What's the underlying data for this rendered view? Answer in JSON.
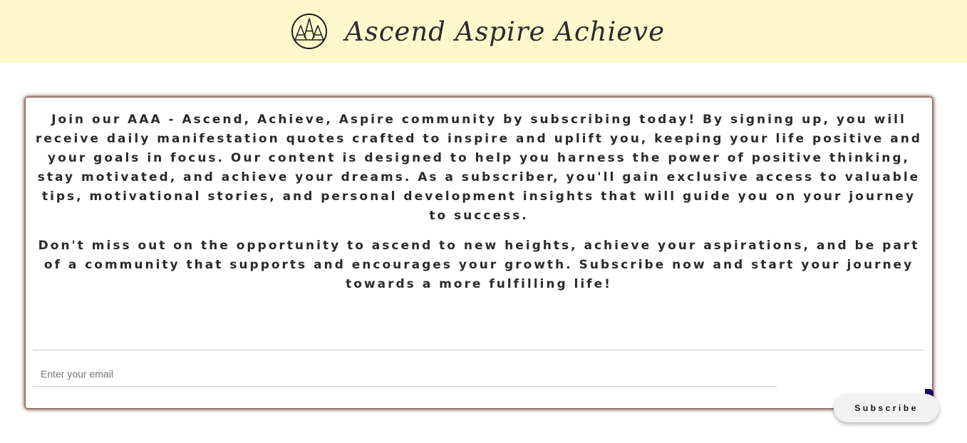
{
  "header": {
    "logo_icon": "AAA-monogram-circle-icon",
    "title": "Ascend Aspire Achieve",
    "background_color": "#fef9cd"
  },
  "card": {
    "paragraph_1": "Join our AAA - Ascend, Achieve, Aspire community by subscribing today! By signing up, you will receive daily manifestation quotes crafted to inspire and uplift you, keeping your life positive and your goals in focus. Our content is designed to help you harness the power of positive thinking, stay motivated, and achieve your dreams. As a subscriber, you'll gain exclusive access to valuable tips, motivational stories, and personal development insights that will guide you on your journey to success.",
    "paragraph_2": "Don't miss out on the opportunity to ascend to new heights, achieve your aspirations, and be part of a community that supports and encourages your growth. Subscribe now and start your journey towards a more fulfilling life!",
    "shadow_color": "#7e5550"
  },
  "form": {
    "email_placeholder": "Enter your email",
    "email_value": "",
    "subscribe_label": "Subscribe",
    "accent_color": "#1a0b57"
  }
}
